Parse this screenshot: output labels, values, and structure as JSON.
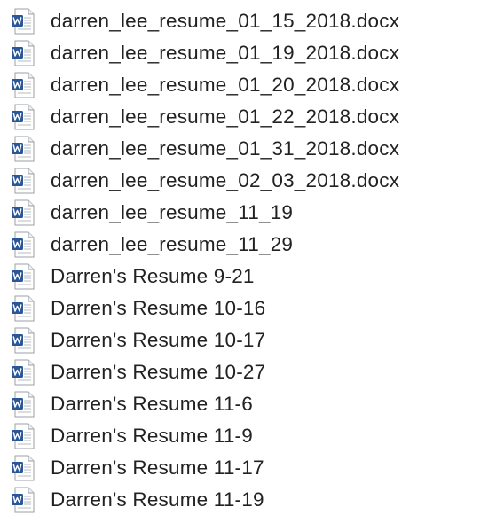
{
  "files": [
    {
      "name": "darren_lee_resume_01_15_2018.docx",
      "icon": "word-document-icon"
    },
    {
      "name": "darren_lee_resume_01_19_2018.docx",
      "icon": "word-document-icon"
    },
    {
      "name": "darren_lee_resume_01_20_2018.docx",
      "icon": "word-document-icon"
    },
    {
      "name": "darren_lee_resume_01_22_2018.docx",
      "icon": "word-document-icon"
    },
    {
      "name": "darren_lee_resume_01_31_2018.docx",
      "icon": "word-document-icon"
    },
    {
      "name": "darren_lee_resume_02_03_2018.docx",
      "icon": "word-document-icon"
    },
    {
      "name": "darren_lee_resume_11_19",
      "icon": "word-document-icon"
    },
    {
      "name": "darren_lee_resume_11_29",
      "icon": "word-document-icon"
    },
    {
      "name": "Darren's Resume 9-21",
      "icon": "word-document-icon"
    },
    {
      "name": "Darren's Resume 10-16",
      "icon": "word-document-icon"
    },
    {
      "name": "Darren's Resume 10-17",
      "icon": "word-document-icon"
    },
    {
      "name": "Darren's Resume 10-27",
      "icon": "word-document-icon"
    },
    {
      "name": "Darren's Resume 11-6",
      "icon": "word-document-icon"
    },
    {
      "name": "Darren's Resume 11-9",
      "icon": "word-document-icon"
    },
    {
      "name": "Darren's Resume 11-17",
      "icon": "word-document-icon"
    },
    {
      "name": "Darren's Resume 11-19",
      "icon": "word-document-icon"
    }
  ],
  "colors": {
    "word_blue": "#2b579a",
    "text": "#222222"
  }
}
